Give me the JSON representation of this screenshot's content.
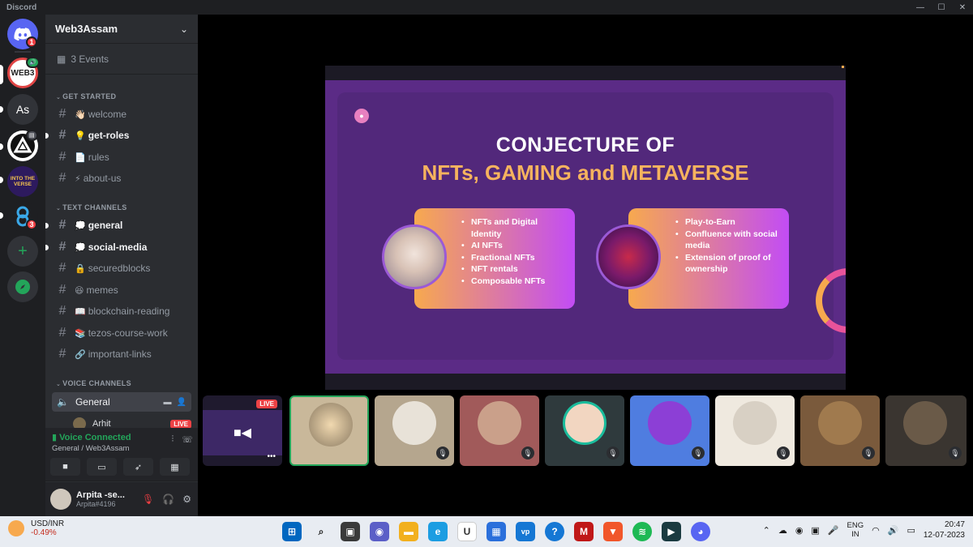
{
  "window": {
    "title": "Discord",
    "controls": [
      "—",
      "☐",
      "✕"
    ]
  },
  "rail": {
    "servers": [
      {
        "name": "home",
        "label": "",
        "badge": "1",
        "bg": "#5865f2"
      },
      {
        "name": "web3assam",
        "label": "WEB3",
        "badge": "",
        "bg": "#ffffff"
      },
      {
        "name": "as",
        "label": "As",
        "badge": "",
        "bg": "#313338"
      },
      {
        "name": "triangle",
        "label": "",
        "badge": "",
        "bg": "#ffffff"
      },
      {
        "name": "into-the-verse",
        "label": "INTO THE VERSE",
        "badge": "",
        "bg": "#2d1a5e"
      },
      {
        "name": "chain",
        "label": "",
        "badge": "3",
        "bg": "#1e1f22"
      }
    ],
    "add_icon": "+",
    "explore_icon": "🧭"
  },
  "guild": {
    "name": "Web3Assam",
    "events": "3 Events"
  },
  "categories": {
    "get_started": "GET STARTED",
    "text": "TEXT CHANNELS",
    "voice": "VOICE CHANNELS"
  },
  "channels": [
    {
      "emoji": "👋🏻",
      "name": "welcome",
      "unread": false
    },
    {
      "emoji": "💡",
      "name": "get-roles",
      "unread": true
    },
    {
      "emoji": "📄",
      "name": "rules",
      "unread": false
    },
    {
      "emoji": "⚡",
      "name": "about-us",
      "unread": false
    },
    {
      "emoji": "💭",
      "name": "general",
      "unread": true
    },
    {
      "emoji": "💭",
      "name": "social-media",
      "unread": true
    },
    {
      "emoji": "🔒",
      "name": "securedblocks",
      "unread": false
    },
    {
      "emoji": "😆",
      "name": "memes",
      "unread": false
    },
    {
      "emoji": "📖",
      "name": "blockchain-reading",
      "unread": false
    },
    {
      "emoji": "📚",
      "name": "tezos-course-work",
      "unread": false
    },
    {
      "emoji": "🔗",
      "name": "important-links",
      "unread": false
    }
  ],
  "voice": {
    "channel": "General",
    "member": "Arhit",
    "live": "LIVE",
    "status": "Voice Connected",
    "sub": "General / Web3Assam"
  },
  "user": {
    "name": "Arpita -se...",
    "tag": "Arpita#4196"
  },
  "slide": {
    "title1": "CONJECTURE OF",
    "title2": "NFTs, GAMING and METAVERSE",
    "left_items": [
      "NFTs and Digital Identity",
      "AI NFTs",
      "Fractional NFTs",
      "NFT rentals",
      "Composable NFTs"
    ],
    "right_items": [
      "Play-to-Earn",
      "Confluence with social media",
      "Extension of proof of ownership"
    ]
  },
  "stream_tile": {
    "live": "LIVE",
    "more": "•••"
  },
  "participants": [
    {
      "bg": "#c9b89a",
      "face": "#8a7a62",
      "selected": true
    },
    {
      "bg": "#b5a68e",
      "face": "#e8e2d8",
      "selected": false
    },
    {
      "bg": "#a15a5a",
      "face": "#caa08a",
      "selected": false
    },
    {
      "bg": "#2f3a3d",
      "face": "#f2d6c1",
      "selected": false
    },
    {
      "bg": "#4f7de0",
      "face": "#8c3fd6",
      "selected": false
    },
    {
      "bg": "#efe9df",
      "face": "#d8d0c4",
      "selected": false
    },
    {
      "bg": "#7a5a3c",
      "face": "#a07a4e",
      "selected": false
    },
    {
      "bg": "#3a3530",
      "face": "#6a5a48",
      "selected": false
    }
  ],
  "taskbar": {
    "ticker": "USD/INR",
    "change": "-0.49%",
    "lang1": "ENG",
    "lang2": "IN",
    "time": "20:47",
    "date": "12-07-2023",
    "apps": [
      {
        "name": "start",
        "glyph": "⊞",
        "bg": "#0067c0"
      },
      {
        "name": "search",
        "glyph": "⌕",
        "bg": "#3a3a3a"
      },
      {
        "name": "task-view",
        "glyph": "▣",
        "bg": "#3a3a3a"
      },
      {
        "name": "chat",
        "glyph": "◉",
        "bg": "#5b5fc7"
      },
      {
        "name": "explorer",
        "glyph": "▬",
        "bg": "#f2b01e"
      },
      {
        "name": "edge",
        "glyph": "e",
        "bg": "#1b9de2"
      },
      {
        "name": "app-u",
        "glyph": "U",
        "bg": "#555555"
      },
      {
        "name": "store",
        "glyph": "▦",
        "bg": "#2a6fdb"
      },
      {
        "name": "app-vp",
        "glyph": "vp",
        "bg": "#1577d4"
      },
      {
        "name": "help",
        "glyph": "?",
        "bg": "#1577d4"
      },
      {
        "name": "mcafee",
        "glyph": "M",
        "bg": "#c01818"
      },
      {
        "name": "brave",
        "glyph": "▼",
        "bg": "#f1562a"
      },
      {
        "name": "spotify",
        "glyph": "≋",
        "bg": "#1db954"
      },
      {
        "name": "app-dark",
        "glyph": "▶",
        "bg": "#1a3a40"
      },
      {
        "name": "discord",
        "glyph": "◕",
        "bg": "#5865f2"
      }
    ]
  },
  "colors": {
    "accent": "#5865f2",
    "online": "#23a55a",
    "danger": "#f23f43",
    "sidebar": "#2b2d31",
    "rail": "#1e1f22"
  }
}
